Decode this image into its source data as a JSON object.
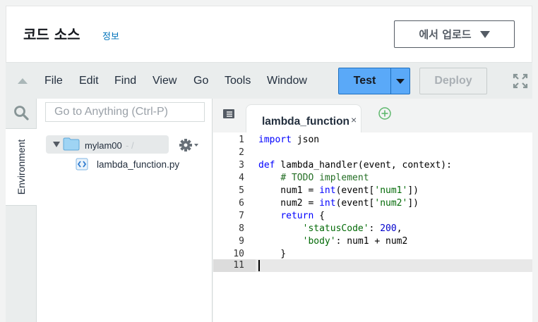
{
  "header": {
    "title": "코드 소스",
    "info_link": "정보",
    "upload_label": "에서 업로드"
  },
  "menubar": {
    "items": [
      "File",
      "Edit",
      "Find",
      "View",
      "Go",
      "Tools",
      "Window"
    ],
    "test_label": "Test",
    "deploy_label": "Deploy"
  },
  "sidebar": {
    "goto_placeholder": "Go to Anything (Ctrl-P)",
    "environment_tab": "Environment",
    "root_folder": "mylam00",
    "root_separator": "- /",
    "file": "lambda_function.py"
  },
  "editor": {
    "tab_label": "lambda_function",
    "tab_close": "×",
    "line_numbers": [
      "1",
      "2",
      "3",
      "4",
      "5",
      "6",
      "7",
      "8",
      "9",
      "10",
      "11"
    ],
    "active_line": 11
  },
  "colors": {
    "accent": "#5aa9f8",
    "link": "#0073bb",
    "keyword": "#0000ff",
    "comment": "#236e24",
    "string": "#036a07"
  },
  "icons": [
    "collapse-up-icon",
    "search-icon",
    "folder-icon",
    "gear-icon",
    "python-file-icon",
    "tab-list-icon",
    "add-tab-icon",
    "fullscreen-icon"
  ]
}
